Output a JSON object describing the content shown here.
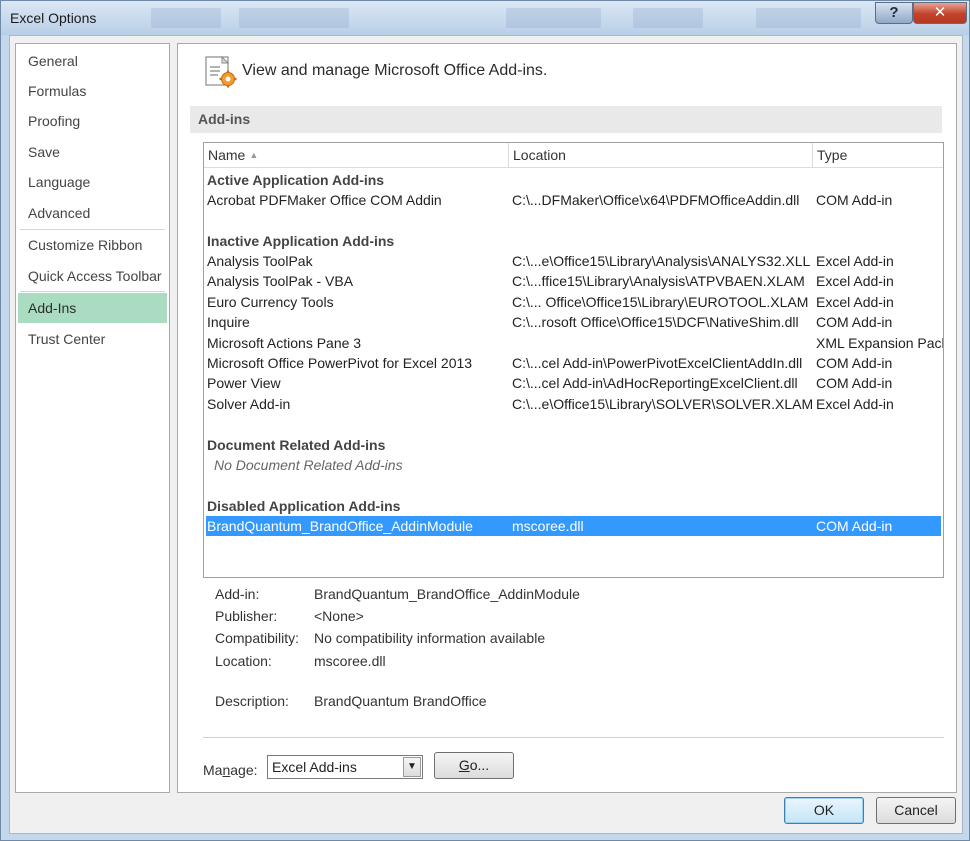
{
  "window": {
    "title": "Excel Options",
    "help_label": "?",
    "close_label": "✕"
  },
  "nav": {
    "items": [
      {
        "label": "General"
      },
      {
        "label": "Formulas"
      },
      {
        "label": "Proofing"
      },
      {
        "label": "Save"
      },
      {
        "label": "Language"
      },
      {
        "label": "Advanced"
      },
      {
        "label": "Customize Ribbon"
      },
      {
        "label": "Quick Access Toolbar"
      },
      {
        "label": "Add-Ins"
      },
      {
        "label": "Trust Center"
      }
    ],
    "selected": "Add-Ins"
  },
  "header": {
    "title": "View and manage Microsoft Office Add-ins."
  },
  "section": {
    "title": "Add-ins"
  },
  "table": {
    "columns": [
      "Name",
      "Location",
      "Type"
    ],
    "sort_indicator": "▲",
    "groups": {
      "active": "Active Application Add-ins",
      "inactive": "Inactive Application Add-ins",
      "document": "Document Related Add-ins",
      "disabled": "Disabled Application Add-ins"
    },
    "active_rows": [
      [
        "Acrobat PDFMaker Office COM Addin",
        "C:\\...DFMaker\\Office\\x64\\PDFMOfficeAddin.dll",
        "COM Add-in"
      ]
    ],
    "inactive_rows": [
      [
        "Analysis ToolPak",
        "C:\\...e\\Office15\\Library\\Analysis\\ANALYS32.XLL",
        "Excel Add-in"
      ],
      [
        "Analysis ToolPak - VBA",
        "C:\\...ffice15\\Library\\Analysis\\ATPVBAEN.XLAM",
        "Excel Add-in"
      ],
      [
        "Euro Currency Tools",
        "C:\\... Office\\Office15\\Library\\EUROTOOL.XLAM",
        "Excel Add-in"
      ],
      [
        "Inquire",
        "C:\\...rosoft Office\\Office15\\DCF\\NativeShim.dll",
        "COM Add-in"
      ],
      [
        "Microsoft Actions Pane 3",
        "",
        "XML Expansion Pack"
      ],
      [
        "Microsoft Office PowerPivot for Excel 2013",
        "C:\\...cel Add-in\\PowerPivotExcelClientAddIn.dll",
        "COM Add-in"
      ],
      [
        "Power View",
        "C:\\...cel Add-in\\AdHocReportingExcelClient.dll",
        "COM Add-in"
      ],
      [
        "Solver Add-in",
        "C:\\...e\\Office15\\Library\\SOLVER\\SOLVER.XLAM",
        "Excel Add-in"
      ]
    ],
    "document_empty": "No Document Related Add-ins",
    "disabled_rows": [
      [
        "BrandQuantum_BrandOffice_AddinModule",
        "mscoree.dll",
        "COM Add-in"
      ]
    ]
  },
  "details": {
    "addin_label": "Add-in:",
    "addin_value": "BrandQuantum_BrandOffice_AddinModule",
    "publisher_label": "Publisher:",
    "publisher_value": "<None>",
    "compat_label": "Compatibility:",
    "compat_value": "No compatibility information available",
    "location_label": "Location:",
    "location_value": "mscoree.dll",
    "description_label": "Description:",
    "description_value": "BrandQuantum BrandOffice"
  },
  "manage": {
    "label_pre": "Ma",
    "label_u": "n",
    "label_post": "age:",
    "selected": "Excel Add-ins",
    "go_u": "G",
    "go_post": "o..."
  },
  "footer": {
    "ok_label": "OK",
    "cancel_label": "Cancel"
  },
  "colors": {
    "selection": "#3399ff",
    "nav_active": "#a9dcc0"
  }
}
